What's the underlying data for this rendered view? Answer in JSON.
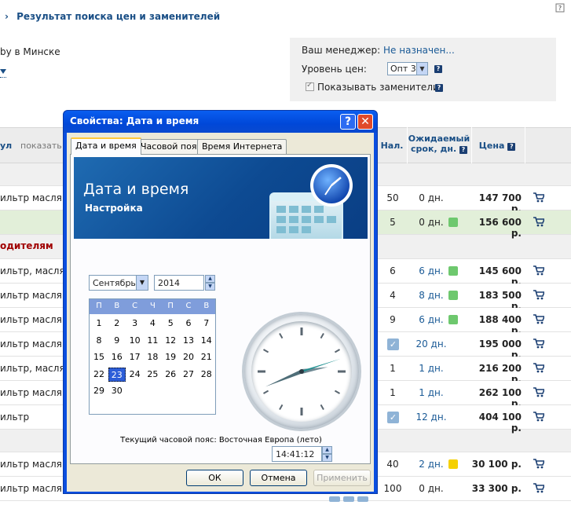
{
  "page": {
    "breadcrumb": "Результат поиска цен и заменителей",
    "city": "by в Минске",
    "manager": {
      "label": "Ваш менеджер:",
      "value": "Не назначен..."
    },
    "price_level": {
      "label": "Уровень цен:",
      "value": "Опт 3"
    },
    "show_replacements": "Показывать заменители",
    "help_mark": "?",
    "table": {
      "headers": {
        "name_partial": "ул",
        "show": "показать",
        "qty": "Нал.",
        "eta_line1": "Ожидаемый",
        "eta_line2": "срок, дн.",
        "price": "Цена"
      },
      "section_label": "одителям",
      "rows": [
        {
          "name": "ильтр маслян",
          "qty": "50",
          "days": "0 дн.",
          "dot": "",
          "tick": false,
          "price": "147 700 р.",
          "style": "white"
        },
        {
          "name": "",
          "qty": "5",
          "days": "0 дн.",
          "dot": "#6ec86e",
          "tick": false,
          "price": "156 600 р.",
          "style": "green"
        },
        {
          "name": "ильтр, маслян",
          "qty": "6",
          "days": "6 дн.",
          "dot": "#6ec86e",
          "tick": false,
          "price": "145 600 р.",
          "style": "white"
        },
        {
          "name": "ильтр маслян",
          "qty": "4",
          "days": "8 дн.",
          "dot": "#6ec86e",
          "tick": false,
          "price": "183 500 р.",
          "style": "white"
        },
        {
          "name": "ильтр маслян",
          "qty": "9",
          "days": "6 дн.",
          "dot": "#6ec86e",
          "tick": false,
          "price": "188 400 р.",
          "style": "white"
        },
        {
          "name": "ильтр маслян",
          "qty": "",
          "days": "20 дн.",
          "dot": "",
          "tick": true,
          "price": "195 000 р.",
          "style": "white"
        },
        {
          "name": "ильтр, маслян",
          "qty": "1",
          "days": "1 дн.",
          "dot": "",
          "tick": false,
          "price": "216 200 р.",
          "style": "white"
        },
        {
          "name": "ильтр маслян",
          "qty": "1",
          "days": "1 дн.",
          "dot": "",
          "tick": false,
          "price": "262 100 р.",
          "style": "white"
        },
        {
          "name": "ильтр",
          "qty": "",
          "days": "12 дн.",
          "dot": "",
          "tick": true,
          "price": "404 100 р.",
          "style": "white"
        },
        {
          "name": "ильтр маслян",
          "qty": "40",
          "days": "2 дн.",
          "dot": "#f5d000",
          "tick": false,
          "price": "30 100 р.",
          "style": "white"
        },
        {
          "name": "ильтр маслян",
          "qty": "100",
          "days": "0 дн.",
          "dot": "",
          "tick": false,
          "price": "33 300 р.",
          "style": "white"
        }
      ]
    }
  },
  "dialog": {
    "title": "Свойства: Дата и время",
    "help_btn": "?",
    "close_btn": "✕",
    "tabs": [
      "Дата и время",
      "Часовой пояс",
      "Время Интернета"
    ],
    "banner_title": "Дата и время",
    "banner_subtitle": "Настройка",
    "month": "Сентябрь",
    "year": "2014",
    "weekdays": [
      "П",
      "В",
      "С",
      "Ч",
      "П",
      "С",
      "В"
    ],
    "days": [
      [
        "1",
        "2",
        "3",
        "4",
        "5",
        "6",
        "7"
      ],
      [
        "8",
        "9",
        "10",
        "11",
        "12",
        "13",
        "14"
      ],
      [
        "15",
        "16",
        "17",
        "18",
        "19",
        "20",
        "21"
      ],
      [
        "22",
        "23",
        "24",
        "25",
        "26",
        "27",
        "28"
      ],
      [
        "29",
        "30",
        "",
        "",
        "",
        "",
        ""
      ]
    ],
    "selected_day": "23",
    "time": "14:41:12",
    "clock": {
      "hours": 14,
      "minutes": 41,
      "seconds": 12
    },
    "timezone_text": "Текущий часовой пояс: Восточная Европа (лето)",
    "buttons": {
      "ok": "ОК",
      "cancel": "Отмена",
      "apply": "Применить"
    }
  }
}
